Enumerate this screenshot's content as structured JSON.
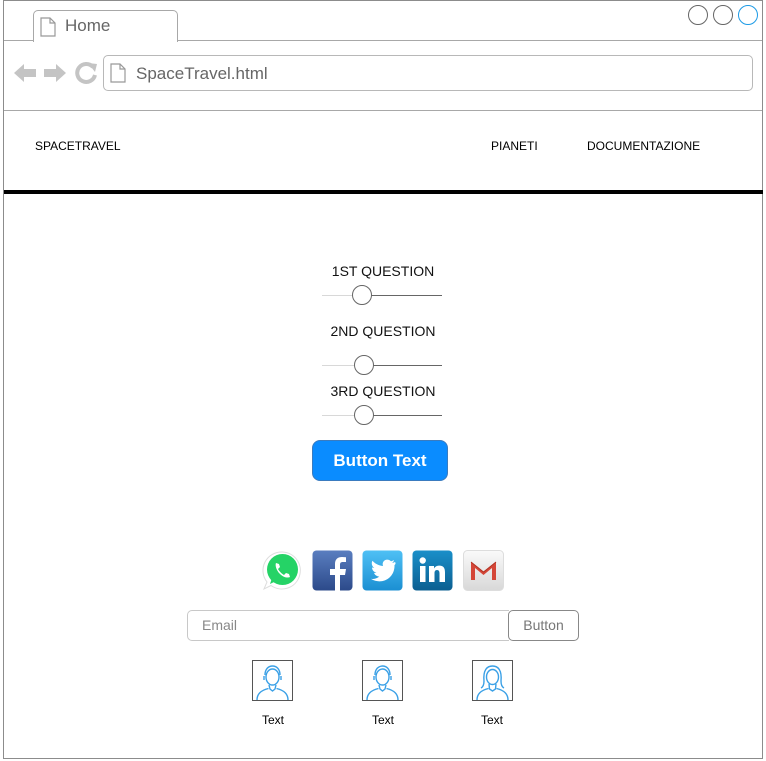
{
  "browser": {
    "tab_label": "Home",
    "url": "SpaceTravel.html"
  },
  "site_nav": {
    "brand": "SPACETRAVEL",
    "links": [
      "PIANETI",
      "DOCUMENTAZIONE"
    ]
  },
  "questions": [
    {
      "label": "1ST QUESTION",
      "value": 0.3
    },
    {
      "label": "2ND QUESTION",
      "value": 0.32
    },
    {
      "label": "3RD QUESTION",
      "value": 0.32
    }
  ],
  "primary_button": "Button Text",
  "social_icons": [
    "whatsapp-icon",
    "facebook-icon",
    "twitter-icon",
    "linkedin-icon",
    "gmail-icon"
  ],
  "newsletter": {
    "email_placeholder": "Email",
    "button_label": "Button"
  },
  "avatars": [
    {
      "icon": "male-avatar-icon",
      "label": "Text"
    },
    {
      "icon": "male-avatar-icon",
      "label": "Text"
    },
    {
      "icon": "female-avatar-icon",
      "label": "Text"
    }
  ],
  "colors": {
    "primary": "#0a8cff",
    "avatar_stroke": "#3aa0e6",
    "whatsapp": "#25d366",
    "facebook": "#3b5998",
    "twitter": "#1da1f2",
    "linkedin": "#0e76a8",
    "gmail": "#d44638"
  }
}
